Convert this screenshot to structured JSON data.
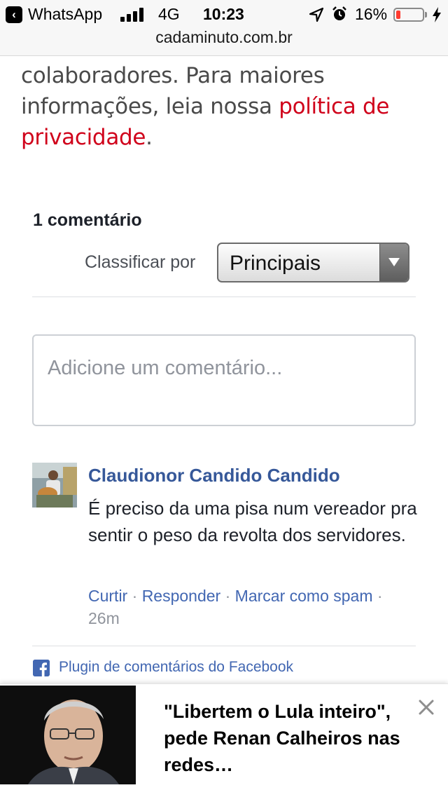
{
  "status_bar": {
    "back_app": "WhatsApp",
    "network": "4G",
    "time": "10:23",
    "battery_percent": "16%",
    "battery_level": 0.16,
    "battery_color": "#ff3b30"
  },
  "browser": {
    "url": "cadaminuto.com.br"
  },
  "article": {
    "text_before": "colaboradores. Para maiores informações, leia nossa ",
    "privacy_link": "política de privacidade",
    "text_after": "."
  },
  "comments": {
    "count_label": "1 comentário",
    "sort_label": "Classificar por",
    "sort_selected": "Principais",
    "input_placeholder": "Adicione um comentário...",
    "items": [
      {
        "author": "Claudionor Candido Candido",
        "text": "É preciso da uma pisa num vereador pra sentir o peso da revolta dos servidores.",
        "actions": [
          "Curtir",
          "Responder",
          "Marcar como spam"
        ],
        "separator": " · ",
        "time": "26m"
      }
    ],
    "plugin_label": "Plugin de comentários do Facebook"
  },
  "ad_banner": {
    "headline": "\"Libertem o Lula inteiro\", pede Renan Calheiros nas redes…"
  },
  "icons": {
    "back": "back-arrow-icon",
    "location": "location-arrow-icon",
    "alarm": "alarm-clock-icon",
    "charging": "lightning-bolt-icon",
    "facebook": "facebook-logo-icon",
    "close": "close-icon",
    "dropdown": "triangle-down-icon"
  },
  "colors": {
    "link_red": "#d0021b",
    "facebook_blue": "#4267b2",
    "author_blue": "#365899"
  }
}
